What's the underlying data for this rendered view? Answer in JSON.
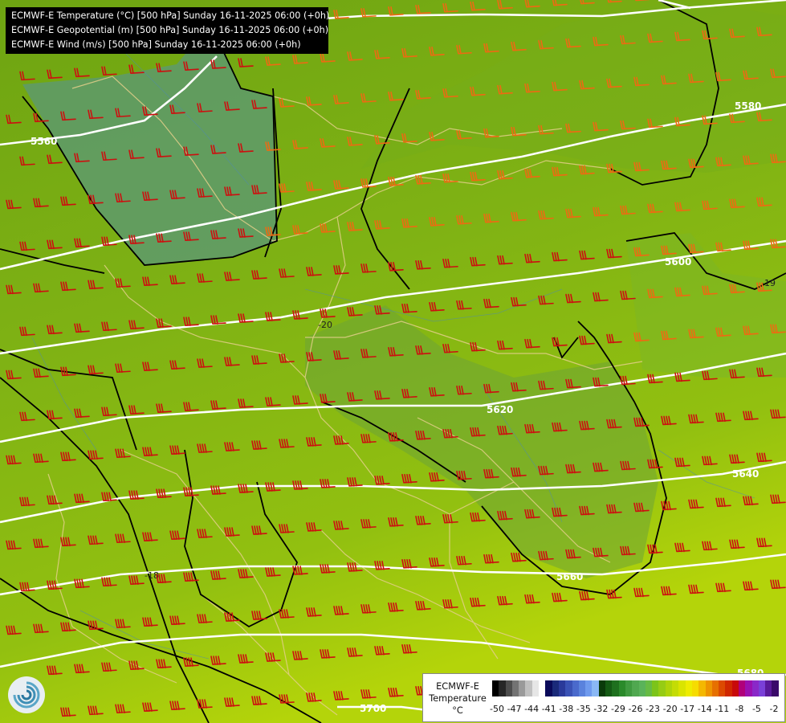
{
  "header": {
    "line1": "ECMWF-E Temperature (°C) [500 hPa] Sunday 16-11-2025 06:00 (+0h)",
    "line2": "ECMWF-E Geopotential (m) [500 hPa] Sunday 16-11-2025 06:00 (+0h)",
    "line3": "ECMWF-E Wind (m/s) [500 hPa] Sunday 16-11-2025 06:00 (+0h)"
  },
  "contours": {
    "geopotential_labels": [
      "5560",
      "5580",
      "5600",
      "5620",
      "5640",
      "5660",
      "5680",
      "5700"
    ],
    "temperature_labels": [
      "-20",
      "-19",
      "-18"
    ]
  },
  "legend": {
    "title_line1": "ECMWF-E",
    "title_line2": "Temperature",
    "unit": "°C",
    "tick_labels": [
      "-50",
      "-47",
      "-44",
      "-41",
      "-38",
      "-35",
      "-32",
      "-29",
      "-26",
      "-23",
      "-20",
      "-17",
      "-14",
      "-11",
      "-8",
      "-5",
      "-2"
    ],
    "colors": [
      "#000000",
      "#262626",
      "#4d4d4d",
      "#737373",
      "#9a9a9a",
      "#c0c0c0",
      "#e6e6e6",
      "#ffffff",
      "#0a0a5a",
      "#1a2a7a",
      "#2a3a9a",
      "#3a52b5",
      "#4a6acc",
      "#5a82dd",
      "#6f9aee",
      "#8ab8f5",
      "#0a3a0a",
      "#145a14",
      "#1e701e",
      "#2a8a2a",
      "#3f9a3f",
      "#50a850",
      "#5ab35a",
      "#66bb44",
      "#7cc41a",
      "#96cc14",
      "#aed40a",
      "#c4dc05",
      "#dae400",
      "#eeec00",
      "#f6dc00",
      "#f4b800",
      "#ee9400",
      "#e67000",
      "#dc4a00",
      "#d02800",
      "#c80a0a",
      "#b0007a",
      "#9a10b0",
      "#8a28c8",
      "#7a40d8",
      "#5a1a9a",
      "#3a0a6a"
    ]
  },
  "icons": {
    "logo": "ecmwf-logo-icon"
  }
}
